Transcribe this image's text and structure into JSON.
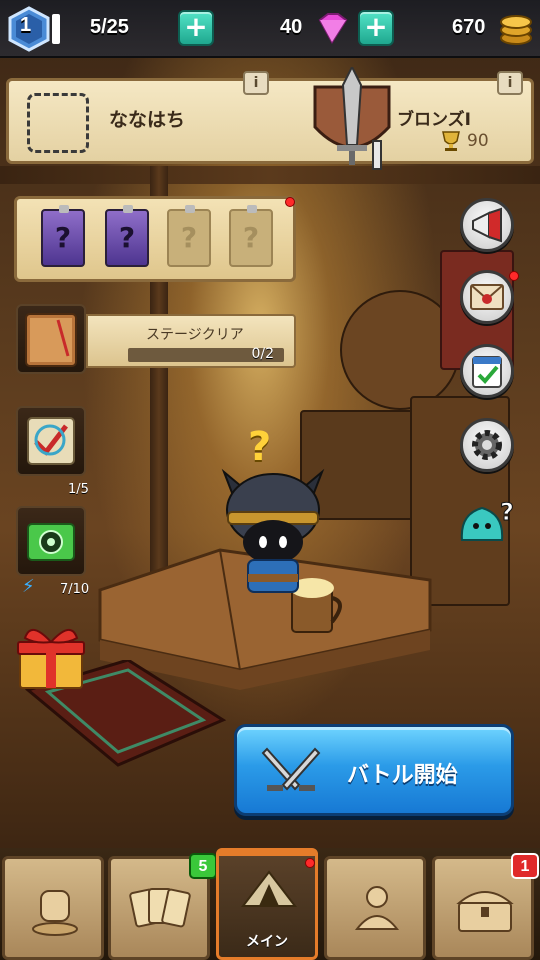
{
  "topbar": {
    "level": "1",
    "stamina": "5/25",
    "gems": "40",
    "coins": "670",
    "colors": {
      "gem": "#e84bd8",
      "coin": "#f0b73a",
      "plus": "#2fc2a6"
    }
  },
  "rank_panel": {
    "player_name": "ななはち",
    "rank_name": "ブロンズⅠ",
    "rank_icon": "bronze-sword-shield-icon",
    "trophies": "90",
    "info_label": "i"
  },
  "cards": {
    "slots": [
      {
        "state": "filled",
        "symbol": "?"
      },
      {
        "state": "filled",
        "symbol": "?"
      },
      {
        "state": "empty",
        "symbol": "?"
      },
      {
        "state": "empty",
        "symbol": "?"
      }
    ]
  },
  "stage": {
    "label": "ステージクリア",
    "progress_text": "0/2",
    "progress": 0.0
  },
  "side": {
    "quest_count": "1/5",
    "camera_count": "7/10"
  },
  "character": {
    "emote": "?"
  },
  "battle": {
    "label": "バトル開始"
  },
  "nav": {
    "tabs": [
      {
        "id": "guild",
        "label": "",
        "icon": "fist-icon",
        "badge": ""
      },
      {
        "id": "cards",
        "label": "",
        "icon": "cards-icon",
        "badge": "5"
      },
      {
        "id": "main",
        "label": "メイン",
        "icon": "tent-icon",
        "badge": ""
      },
      {
        "id": "friends",
        "label": "",
        "icon": "people-icon",
        "badge": ""
      },
      {
        "id": "shop",
        "label": "",
        "icon": "chest-icon",
        "badge": "1"
      }
    ]
  }
}
